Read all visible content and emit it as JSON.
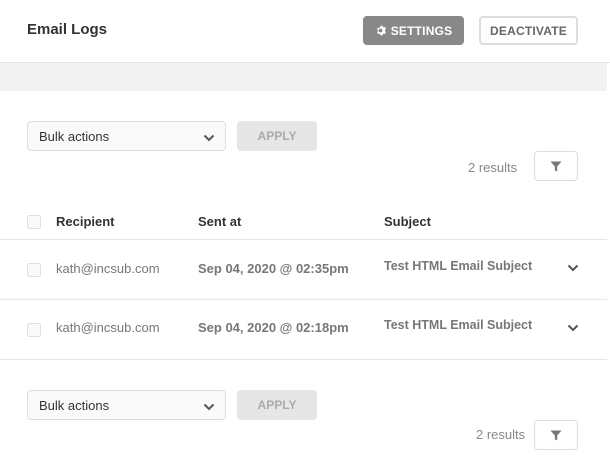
{
  "header": {
    "title": "Email Logs",
    "settings_label": "SETTINGS",
    "deactivate_label": "DEACTIVATE"
  },
  "bulk": {
    "select_value": "Bulk actions",
    "apply_label": "APPLY",
    "results_text": "2 results"
  },
  "table": {
    "columns": [
      "Recipient",
      "Sent at",
      "Subject"
    ],
    "rows": [
      {
        "recipient": "kath@incsub.com",
        "sent_at": "Sep 04, 2020 @ 02:35pm",
        "subject": "Test HTML Email Subject"
      },
      {
        "recipient": "kath@incsub.com",
        "sent_at": "Sep 04, 2020 @ 02:18pm",
        "subject": "Test HTML Email Subject"
      }
    ]
  },
  "icons": {
    "settings": "gear-icon",
    "filter": "filter-icon",
    "dropdown": "chevron-down-icon",
    "expand": "chevron-down-icon"
  },
  "colors": {
    "settings_bg": "#888888",
    "band_bg": "#f2f2f2",
    "apply_bg": "#e6e6e6"
  }
}
